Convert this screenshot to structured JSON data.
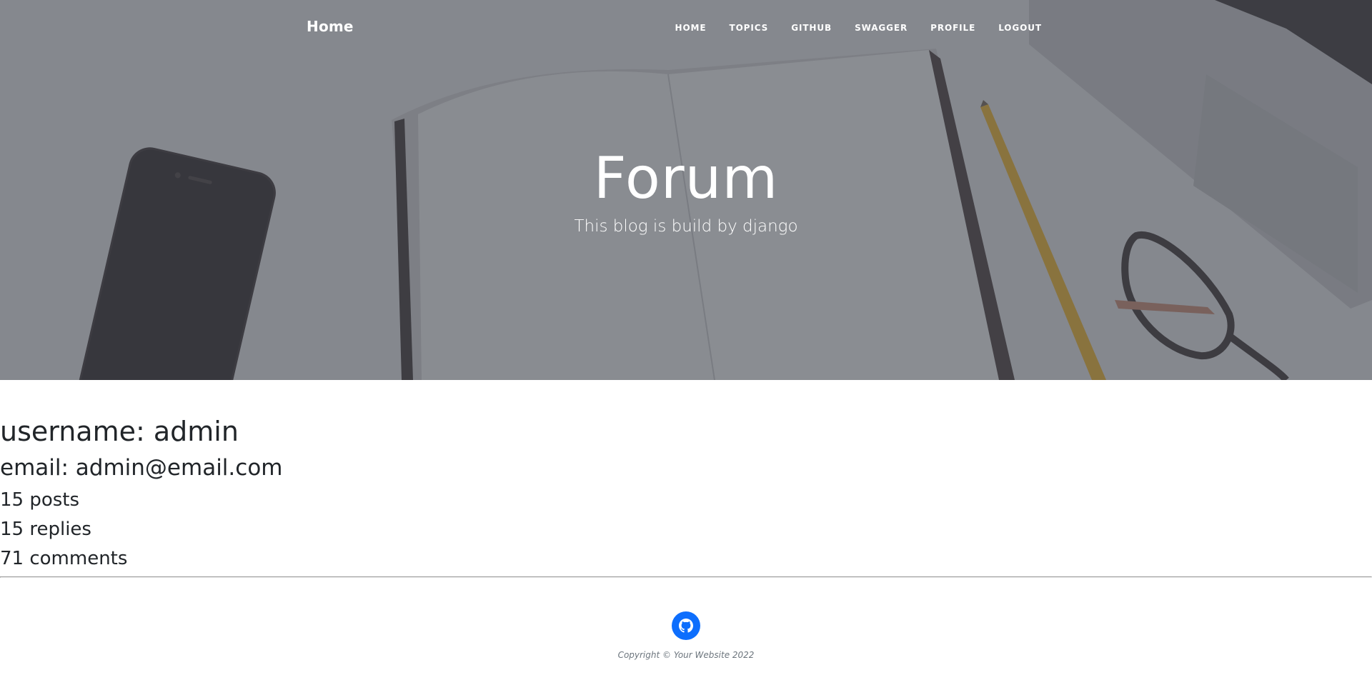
{
  "navbar": {
    "brand": "Home",
    "links": [
      "HOME",
      "TOPICS",
      "GITHUB",
      "SWAGGER",
      "PROFILE",
      "LOGOUT"
    ]
  },
  "hero": {
    "title": "Forum",
    "subtitle": "This blog is build by django"
  },
  "profile": {
    "username": "username: admin",
    "email": "email: admin@email.com",
    "stats": [
      "15 posts",
      "15 replies",
      "71 comments"
    ]
  },
  "footer": {
    "github_icon": "github-icon",
    "copyright": "Copyright © Your Website 2022"
  },
  "colors": {
    "accent": "#0d6efd",
    "text": "#212529",
    "muted": "#6c757d"
  }
}
